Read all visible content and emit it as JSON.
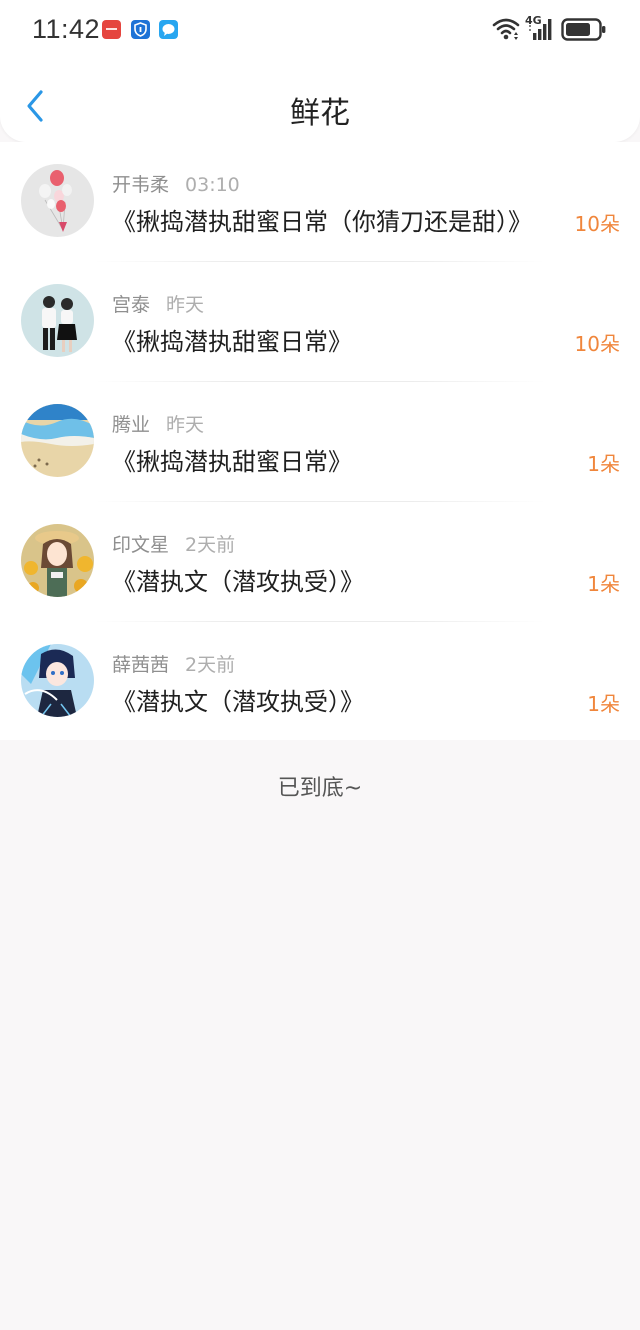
{
  "status_bar": {
    "time": "11:42",
    "app_icons": [
      "huawei-app-icon",
      "shield-app-icon",
      "chat-app-icon"
    ],
    "network": "4G",
    "system_icons": [
      "wifi-icon",
      "signal-icon",
      "battery-icon"
    ]
  },
  "header": {
    "back_icon": "chevron-left-icon",
    "title": "鲜花"
  },
  "items": [
    {
      "name": "开韦柔",
      "time": "03:10",
      "work": "《揪捣潜执甜蜜日常（你猜刀还是甜）》",
      "count": "10朵"
    },
    {
      "name": "宫泰",
      "time": "昨天",
      "work": "《揪捣潜执甜蜜日常》",
      "count": "10朵"
    },
    {
      "name": "腾业",
      "time": "昨天",
      "work": "《揪捣潜执甜蜜日常》",
      "count": "1朵"
    },
    {
      "name": "印文星",
      "time": "2天前",
      "work": "《潜执文（潜攻执受）》",
      "count": "1朵"
    },
    {
      "name": "薛茜茜",
      "time": "2天前",
      "work": "《潜执文（潜攻执受）》",
      "count": "1朵"
    }
  ],
  "footer": "已到底~",
  "colors": {
    "accent_blue": "#2a97e6",
    "count_orange": "#f0863c",
    "page_bg": "#f9f7f8"
  }
}
